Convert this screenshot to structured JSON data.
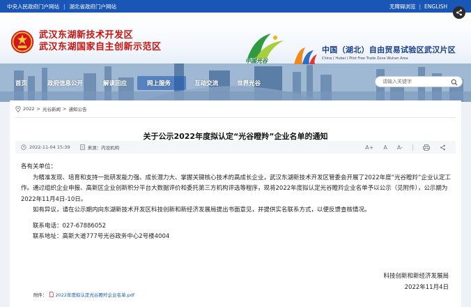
{
  "topbar": {
    "link_central": "中央人民政府门户网站",
    "link_hubei": "湖北省政府门户网站",
    "accessibility": "无障碍浏览",
    "english": "ENGLISH"
  },
  "header": {
    "org_line1": "武汉东湖新技术开发区",
    "org_line2": "武汉东湖国家自主创新示范区",
    "optics_logo_text": "中国光谷",
    "ftz_title": "中国（湖北）自由贸易试验区武汉片区",
    "ftz_subtitle": "China ( Hubei ) Pilot Free Trade Zone Wuhan Area"
  },
  "nav": {
    "items": [
      {
        "label": "首页"
      },
      {
        "label": "政府信息公开"
      },
      {
        "label": "解读回应"
      },
      {
        "label": "网上服务"
      },
      {
        "label": "互动交流"
      },
      {
        "label": "世界光谷"
      }
    ],
    "active_index": 3
  },
  "search": {
    "placeholder": "请输入关键字"
  },
  "breadcrumb": {
    "items": [
      "2022",
      "光谷新闻",
      "通知公告"
    ],
    "separator": ">"
  },
  "article": {
    "title": "关于公示2022年度拟认定“光谷瞪羚”企业名单的通知",
    "date": "2022-11-04 15:39",
    "source": "来源：内设机构",
    "font_large": "A+",
    "font_normal": "A",
    "font_small": "A-",
    "salutation": "各有关单位：",
    "para1": "为精准发现、培育和支持一批研发能力强、成长潜力大、掌握关键核心技术的高成长企业，武汉东湖新技术开发区管委会开展了2022年度“光谷瞪羚”企业认定工作。通过组织企业申报、高新区企业创新积分平台大数据评价和委托第三方机构评选等程序，现将2022年度拟认定光谷瞪羚企业名单予以公示（见附件），公示期为2022年11月4日-10日。",
    "para2": "如有异议，请在公示期内向东湖新技术开发区科技创新和新经济发展局提出书面意见，并提供实名联系方式，以便反馈查核情况。",
    "phone": "联系电话：027-67886052",
    "address": "联系地址：高新大道777号光谷政务中心2号楼4004",
    "signer": "科技创新和新经济发展局",
    "sign_date": "2022年11月4日",
    "attachment_label": "附件：",
    "attachment_name": "2022年度拟认定光谷瞪羚企业名单.pdf"
  },
  "colors": {
    "brand_blue": "#1a56b5",
    "title_red": "#c8140f",
    "optics_green": "#1e7b3a"
  }
}
